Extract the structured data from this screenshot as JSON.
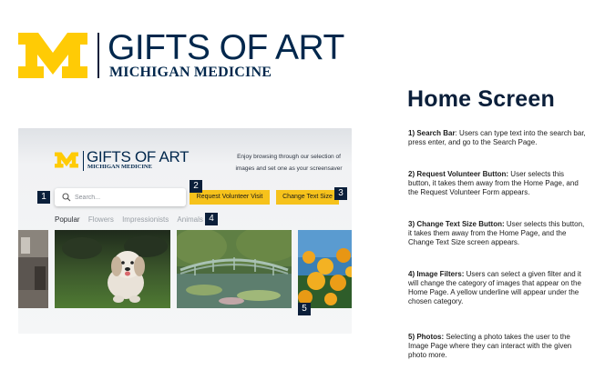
{
  "header": {
    "logo_icon": "block-m-logo",
    "title": "GIFTS OF ART",
    "subtitle": "MICHIGAN MEDICINE"
  },
  "mockup": {
    "logo_title": "GIFTS OF ART",
    "logo_subtitle": "MICHIGAN MEDICINE",
    "blurb": "Enjoy browsing through our selection of images and set one as your screensaver",
    "search": {
      "placeholder": "Search...",
      "value": "",
      "icon": "search-icon"
    },
    "buttons": {
      "volunteer": "Request Volunteer Visit",
      "text_size": "Change Text Size"
    },
    "filters": [
      "Popular",
      "Flowers",
      "Impressionists",
      "Animals"
    ],
    "active_filter": "Popular",
    "photos": [
      "interior-photo",
      "dog-photo",
      "bridge-painting",
      "flowers-photo"
    ],
    "badges": [
      "1",
      "2",
      "3",
      "4",
      "5"
    ]
  },
  "panel": {
    "heading": "Home Screen",
    "items": [
      {
        "label": "1) Search Bar",
        "text": ": Users can type text into the search bar, press enter, and go to the Search Page."
      },
      {
        "label": "2) Request Volunteer Button:",
        "text": " User selects this button, it takes them away from the Home Page, and the Request Volunteer Form appears."
      },
      {
        "label": "3) Change Text Size Button:",
        "text": " User selects this button, it takes them away from the Home Page, and the Change Text Size screen appears."
      },
      {
        "label": "4) Image Filters:",
        "text": " Users can select a given filter and it will change the category of images that appear on the Home Page. A yellow underline will appear under the chosen category."
      },
      {
        "label": "5) Photos:",
        "text": " Selecting a photo takes the user to the Image Page where they can interact with the given photo more."
      }
    ]
  },
  "colors": {
    "navy": "#00274c",
    "maize": "#ffcb05",
    "button_yellow": "#f6c21b"
  }
}
